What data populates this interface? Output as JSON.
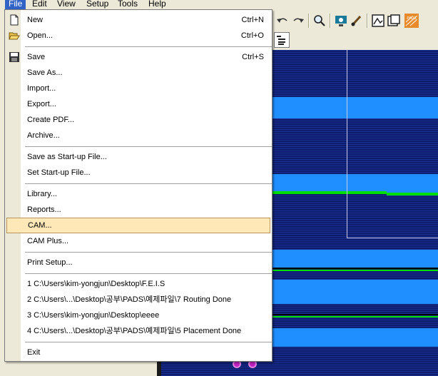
{
  "menubar": {
    "items": [
      {
        "label": "File",
        "active": true
      },
      {
        "label": "Edit",
        "active": false
      },
      {
        "label": "View",
        "active": false
      },
      {
        "label": "Setup",
        "active": false
      },
      {
        "label": "Tools",
        "active": false
      },
      {
        "label": "Help",
        "active": false
      }
    ]
  },
  "toolbar": {
    "icons": [
      "undo-icon",
      "redo-icon",
      "zoom-icon",
      "view-icon",
      "brush-icon",
      "picture-icon",
      "window-icon",
      "pads-icon"
    ],
    "pads_logo": "PADS"
  },
  "file_menu": {
    "new": {
      "label": "New",
      "shortcut": "Ctrl+N"
    },
    "open": {
      "label": "Open...",
      "shortcut": "Ctrl+O"
    },
    "save": {
      "label": "Save",
      "shortcut": "Ctrl+S"
    },
    "save_as": {
      "label": "Save As..."
    },
    "import": {
      "label": "Import..."
    },
    "export": {
      "label": "Export..."
    },
    "create_pdf": {
      "label": "Create PDF..."
    },
    "archive": {
      "label": "Archive..."
    },
    "save_startup": {
      "label": "Save as Start-up File..."
    },
    "set_startup": {
      "label": "Set Start-up File..."
    },
    "library": {
      "label": "Library..."
    },
    "reports": {
      "label": "Reports..."
    },
    "cam": {
      "label": "CAM..."
    },
    "cam_plus": {
      "label": "CAM Plus..."
    },
    "print_setup": {
      "label": "Print Setup..."
    },
    "recent": [
      "1 C:\\Users\\kim-yongjun\\Desktop\\F.E.I.S",
      "2 C:\\Users\\...\\Desktop\\공부\\PADS\\예제파일\\7 Routing Done",
      "3 C:\\Users\\kim-yongjun\\Desktop\\eeee",
      "4 C:\\Users\\...\\Desktop\\공부\\PADS\\예제파일\\5 Placement Done"
    ],
    "exit": {
      "label": "Exit"
    }
  },
  "colors": {
    "highlight": "#ffe8b8",
    "highlight_border": "#b8935a",
    "canvas_dark": "#0e1d6e",
    "canvas_band": "#1f8fff",
    "trace_green": "#00e000",
    "via": "#c020c0"
  }
}
